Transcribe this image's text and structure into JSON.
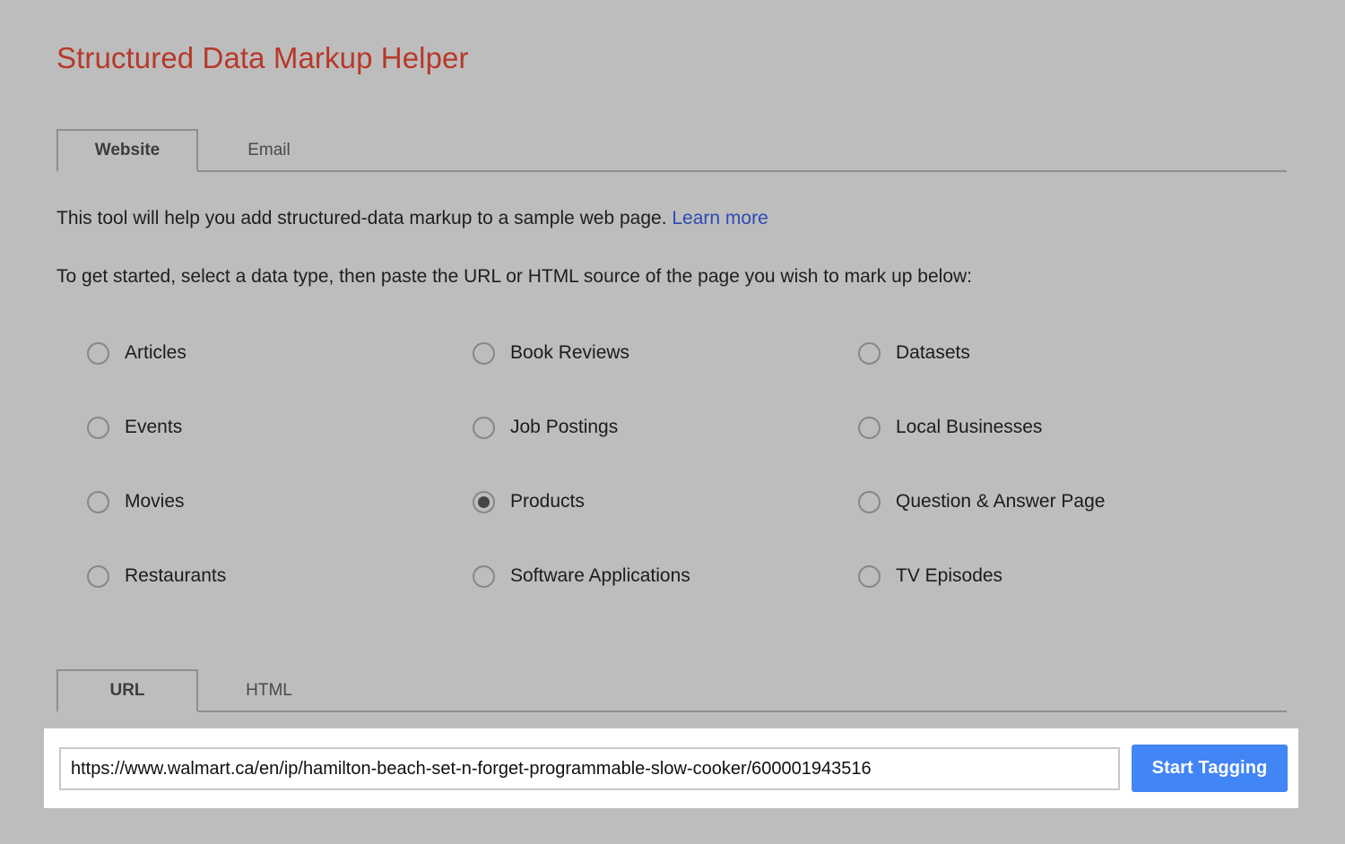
{
  "app": {
    "title": "Structured Data Markup Helper",
    "title_color": "#b7382a",
    "background_color": "#bdbdbd"
  },
  "source_tabs": {
    "items": [
      {
        "label": "Website",
        "selected": true
      },
      {
        "label": "Email",
        "selected": false
      }
    ]
  },
  "intro": {
    "line1_text": "This tool will help you add structured-data markup to a sample web page.",
    "line1_link": "Learn more",
    "line1_link_color": "#2b4bb5",
    "line2": "To get started, select a data type, then paste the URL or HTML source of the page you wish to mark up below:"
  },
  "data_types": {
    "selected": "Products",
    "options": [
      {
        "label": "Articles",
        "checked": false
      },
      {
        "label": "Book Reviews",
        "checked": false
      },
      {
        "label": "Datasets",
        "checked": false
      },
      {
        "label": "Events",
        "checked": false
      },
      {
        "label": "Job Postings",
        "checked": false
      },
      {
        "label": "Local Businesses",
        "checked": false
      },
      {
        "label": "Movies",
        "checked": false
      },
      {
        "label": "Products",
        "checked": true
      },
      {
        "label": "Question & Answer Page",
        "checked": false
      },
      {
        "label": "Restaurants",
        "checked": false
      },
      {
        "label": "Software Applications",
        "checked": false
      },
      {
        "label": "TV Episodes",
        "checked": false
      }
    ]
  },
  "input_tabs": {
    "items": [
      {
        "label": "URL",
        "selected": true
      },
      {
        "label": "HTML",
        "selected": false
      }
    ]
  },
  "action_bar": {
    "url_value": "https://www.walmart.ca/en/ip/hamilton-beach-set-n-forget-programmable-slow-cooker/600001943516",
    "url_placeholder": "",
    "start_label": "Start Tagging",
    "start_color": "#4285f4"
  }
}
